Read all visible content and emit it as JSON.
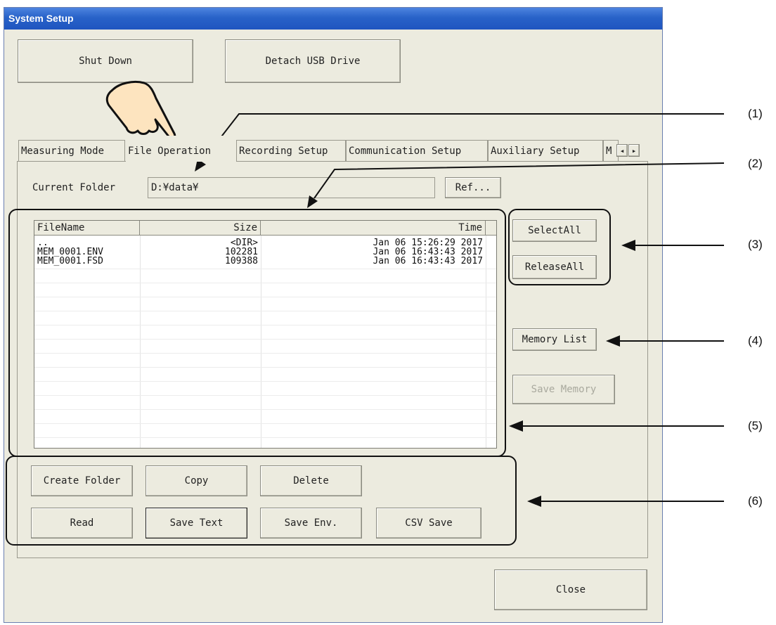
{
  "window": {
    "title": "System Setup"
  },
  "top_buttons": {
    "shut_down": "Shut Down",
    "detach_usb": "Detach USB Drive"
  },
  "tabs": [
    {
      "label": "Measuring Mode",
      "active": false
    },
    {
      "label": "File Operation",
      "active": true
    },
    {
      "label": "Recording Setup",
      "active": false
    },
    {
      "label": "Communication Setup",
      "active": false
    },
    {
      "label": "Auxiliary Setup",
      "active": false
    },
    {
      "label": "M",
      "active": false
    }
  ],
  "tab_scroll": {
    "left": "◂",
    "right": "▸"
  },
  "current_folder": {
    "label": "Current Folder",
    "value": "D:¥data¥",
    "ref_button": "Ref..."
  },
  "file_list": {
    "columns": {
      "name": "FileName",
      "size": "Size",
      "time": "Time"
    },
    "rows": [
      {
        "name": "..",
        "size": "<DIR>",
        "time": "Jan 06 15:26:29 2017"
      },
      {
        "name": "MEM_0001.ENV",
        "size": "102281",
        "time": "Jan 06 16:43:43 2017"
      },
      {
        "name": "MEM_0001.FSD",
        "size": "109388",
        "time": "Jan 06 16:43:43 2017"
      }
    ]
  },
  "side_buttons": {
    "select_all": "SelectAll",
    "release_all": "ReleaseAll",
    "memory_list": "Memory List",
    "save_memory": "Save Memory"
  },
  "bottom_buttons": {
    "create_folder": "Create Folder",
    "copy": "Copy",
    "delete": "Delete",
    "read": "Read",
    "save_text": "Save Text",
    "save_env": "Save Env.",
    "csv_save": "CSV Save"
  },
  "close_button": "Close",
  "callouts": [
    "(1)",
    "(2)",
    "(3)",
    "(4)",
    "(5)",
    "(6)"
  ]
}
